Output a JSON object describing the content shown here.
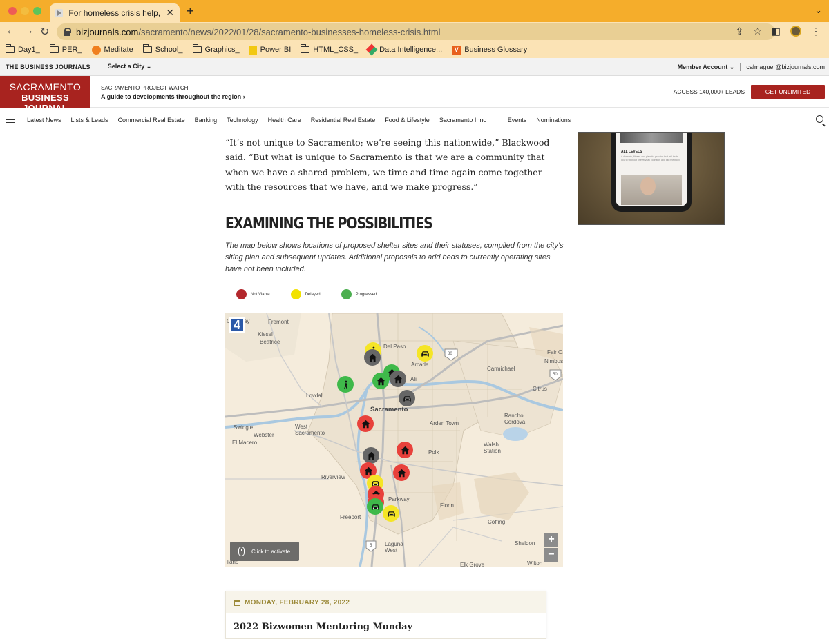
{
  "browser": {
    "tab_title": "For homeless crisis help, city tu",
    "tab_close": "✕",
    "new_tab": "+",
    "chevron": "⌄",
    "url_host": "bizjournals.com",
    "url_path": "/sacramento/news/2022/01/28/sacramento-businesses-homeless-crisis.html",
    "bookmarks": [
      {
        "label": "Day1_",
        "icon": "folder-icon"
      },
      {
        "label": "PER_",
        "icon": "folder-icon"
      },
      {
        "label": "Meditate",
        "icon": "orange-circle-icon"
      },
      {
        "label": "School_",
        "icon": "folder-icon"
      },
      {
        "label": "Graphics_",
        "icon": "folder-icon"
      },
      {
        "label": "Power BI",
        "icon": "powerbi-icon"
      },
      {
        "label": "HTML_CSS_",
        "icon": "folder-icon"
      },
      {
        "label": "Data Intelligence...",
        "icon": "data-intelligence-icon"
      },
      {
        "label": "Business Glossary",
        "icon": "v-icon"
      }
    ]
  },
  "site": {
    "network": "THE BUSINESS JOURNALS",
    "select_city": "Select a City",
    "member_account": "Member Account",
    "user_email": "calmaguer@bizjournals.com",
    "logo_line1": "SACRAMENTO",
    "logo_line2": "BUSINESS JOURNAL",
    "project_label": "SACRAMENTO PROJECT WATCH",
    "project_guide": "A guide to developments throughout the region",
    "access": "ACCESS 140,000+ LEADS",
    "cta": "GET UNLIMITED",
    "nav": [
      "Latest News",
      "Lists & Leads",
      "Commercial Real Estate",
      "Banking",
      "Technology",
      "Health Care",
      "Residential Real Estate",
      "Food & Lifestyle",
      "Sacramento Inno",
      "|",
      "Events",
      "Nominations"
    ]
  },
  "article": {
    "quote": "“It’s not unique to Sacramento; we’re seeing this nationwide,” Blackwood said. “But what is unique to Sacramento is that we are a community that when we have a shared problem, we time and time again come together with the resources that we have, and we make progress.”",
    "section_title": "EXAMINING THE POSSIBILITIES",
    "intro": "The map below shows locations of proposed shelter sites and their statuses, compiled from the city’s siting plan and subsequent updates. Additional proposals to add beds to currently operating sites have not been included.",
    "legend": [
      {
        "label": "Not Viable",
        "color": "#b3282d"
      },
      {
        "label": "Delayed",
        "color": "#f2e200"
      },
      {
        "label": "Progressed",
        "color": "#4caf50"
      }
    ]
  },
  "map": {
    "channel": "4",
    "activate": "Click to activate",
    "zoom_in": "+",
    "zoom_out": "−",
    "places": [
      "Conaway",
      "Fremont",
      "Kiesel",
      "Beatrice",
      "Del Paso",
      "Arcade",
      "Fair Oaks",
      "Nimbus",
      "Carmichael",
      "Lovdal",
      "Citrus",
      "Sacramento",
      "Swingle",
      "Webster",
      "West Sacramento",
      "El Macero",
      "Arden Town",
      "Rancho Cordova",
      "Walsh Station",
      "Polk",
      "Riverview",
      "Freeport",
      "Florin",
      "Coffing",
      "Sheldon",
      "Laguna West",
      "Elk Grove",
      "Wilton",
      "Ilano",
      "Ali",
      "Parkway"
    ],
    "highways": [
      "80",
      "50",
      "5"
    ],
    "colors": {
      "not_viable": "#e8413b",
      "delayed": "#f5e526",
      "progressed": "#3fb94a",
      "unknown": "#666666"
    },
    "markers": [
      {
        "status": "delayed",
        "icon": "person-icon"
      },
      {
        "status": "unknown",
        "icon": "house-icon"
      },
      {
        "status": "delayed",
        "icon": "car-icon"
      },
      {
        "status": "progressed",
        "icon": "house-icon"
      },
      {
        "status": "progressed",
        "icon": "person-icon"
      },
      {
        "status": "progressed",
        "icon": "house-icon"
      },
      {
        "status": "unknown",
        "icon": "house-icon"
      },
      {
        "status": "unknown",
        "icon": "car-icon"
      },
      {
        "status": "not_viable",
        "icon": "house-icon"
      },
      {
        "status": "not_viable",
        "icon": "house-icon"
      },
      {
        "status": "unknown",
        "icon": "house-icon"
      },
      {
        "status": "not_viable",
        "icon": "house-icon"
      },
      {
        "status": "not_viable",
        "icon": "house-icon"
      },
      {
        "status": "delayed",
        "icon": "car-icon"
      },
      {
        "status": "not_viable",
        "icon": "house-icon"
      },
      {
        "status": "not_viable",
        "icon": "car-icon"
      },
      {
        "status": "progressed",
        "icon": "car-icon"
      },
      {
        "status": "delayed",
        "icon": "car-icon"
      }
    ]
  },
  "ad": {
    "levels": "ALL LEVELS",
    "blurb": "A dynamic, fitness and pieceful practice that will invite you to step out of everyday cognition and into the body."
  },
  "event": {
    "date": "MONDAY, FEBRUARY 28, 2022",
    "title": "2022 Bizwomen Mentoring Monday"
  }
}
